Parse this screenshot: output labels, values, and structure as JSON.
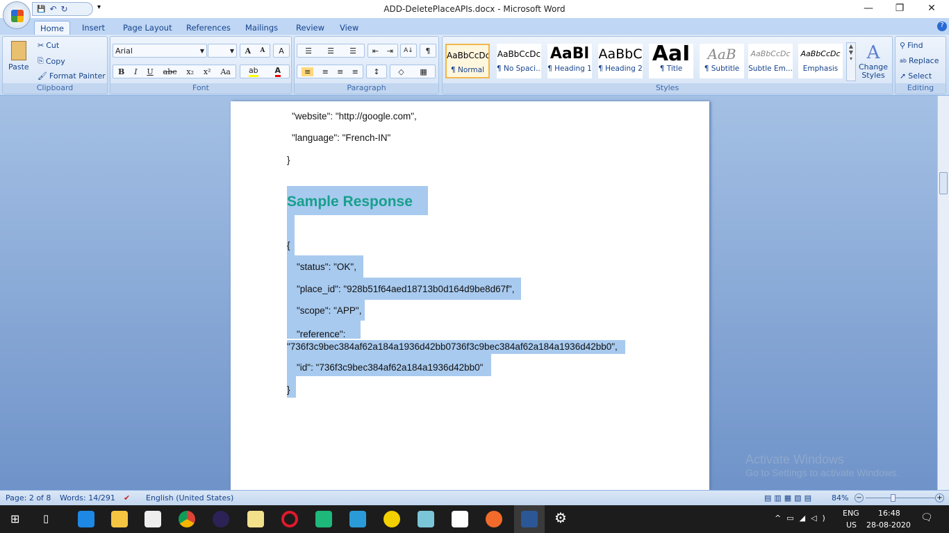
{
  "window": {
    "title": "ADD-DeletePlaceAPIs.docx - Microsoft Word",
    "minimize": "—",
    "restore": "❐",
    "close": "✕"
  },
  "qat": {
    "save": "💾",
    "undo": "↶",
    "redo": "↻",
    "more": "▾"
  },
  "tabs": [
    "Home",
    "Insert",
    "Page Layout",
    "References",
    "Mailings",
    "Review",
    "View"
  ],
  "help": "?",
  "clipboard": {
    "paste": "Paste",
    "cut": "Cut",
    "copy": "Copy",
    "format_painter": "Format Painter",
    "label": "Clipboard"
  },
  "font": {
    "name": "Arial",
    "size": "",
    "grow": "A",
    "shrink": "A",
    "clear": "A",
    "bold": "B",
    "italic": "I",
    "underline": "U",
    "strike": "abc",
    "sub": "x₂",
    "sup": "x²",
    "case": "Aa",
    "highlight": "ab",
    "color": "A",
    "label": "Font"
  },
  "paragraph": {
    "bullets": "☰",
    "numbering": "☰",
    "multilevel": "☰",
    "dec_indent": "⇤",
    "inc_indent": "⇥",
    "sort": "A↓",
    "pilcrow": "¶",
    "align_left": "≡",
    "center": "≡",
    "right": "≡",
    "justify": "≡",
    "spacing": "↕",
    "shading": "◇",
    "borders": "▦",
    "label": "Paragraph"
  },
  "styles": {
    "items": [
      {
        "preview": "AaBbCcDc",
        "name": "¶ Normal"
      },
      {
        "preview": "AaBbCcDc",
        "name": "¶ No Spaci..."
      },
      {
        "preview": "AaBl",
        "name": "¶ Heading 1"
      },
      {
        "preview": "AaBbC",
        "name": "¶ Heading 2"
      },
      {
        "preview": "AaI",
        "name": "¶ Title"
      },
      {
        "preview": "AaB",
        "name": "¶ Subtitle"
      },
      {
        "preview": "AaBbCcDc",
        "name": "Subtle Em..."
      },
      {
        "preview": "AaBbCcDc",
        "name": "Emphasis"
      }
    ],
    "change": "Change Styles",
    "change_icon": "A",
    "label": "Styles"
  },
  "editing": {
    "find": "Find",
    "replace": "Replace",
    "select": "Select",
    "label": "Editing"
  },
  "document": {
    "lines_before": [
      "\"website\": \"http://google.com\",",
      "\"language\": \"French-IN\"",
      "}"
    ],
    "heading": "Sample Response",
    "open_brace": "{",
    "status": "\"status\": \"OK\",",
    "place_id": "\"place_id\": \"928b51f64aed18713b0d164d9be8d67f\",",
    "scope": "\"scope\": \"APP\",",
    "reference_key": "\"reference\":",
    "reference_val": "\"736f3c9bec384af62a184a1936d42bb0736f3c9bec384af62a184a1936d42bb0\",",
    "id": "\"id\": \"736f3c9bec384af62a184a1936d42bb0\"",
    "close_brace": "}"
  },
  "watermark": {
    "title": "Activate Windows",
    "sub": "Go to Settings to activate Windows."
  },
  "statusbar": {
    "page": "Page: 2 of 8",
    "words": "Words: 14/291",
    "language": "English (United States)",
    "zoom": "84%",
    "zoom_value": 84
  },
  "taskbar": {
    "lang1": "ENG",
    "lang2": "US",
    "time": "16:48",
    "date": "28-08-2020"
  },
  "colors": {
    "heading": "#17a08c",
    "selection": "#a8caef"
  }
}
